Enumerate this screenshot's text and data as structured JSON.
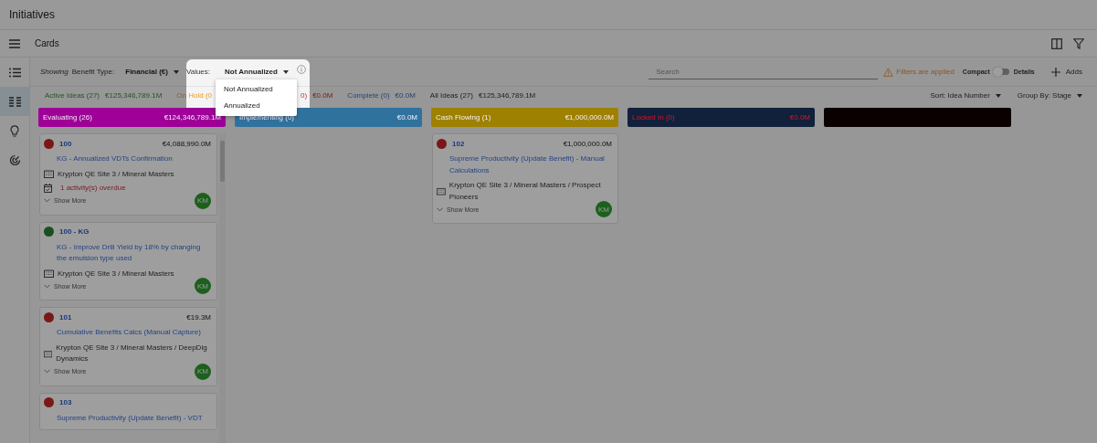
{
  "window": {
    "title": "Initiatives"
  },
  "header": {
    "title": "Cards"
  },
  "sidebar": {
    "items": [
      {
        "kind": "list",
        "selected": false
      },
      {
        "kind": "cards",
        "selected": true
      },
      {
        "kind": "idea",
        "selected": false
      },
      {
        "kind": "radar",
        "selected": false
      }
    ]
  },
  "toolbar": {
    "showing": "Showing",
    "benefit_type_label": "Benefit Type:",
    "benefit_type": "Financial (€)",
    "values_label": "Values:",
    "values": "Not Annualized",
    "values_options": [
      "Not Annualized",
      "Annualized"
    ],
    "search": {
      "placeholder": "Search"
    },
    "filters_notice": "Filters are applied",
    "toggle": {
      "off_label": "Compact",
      "on_label": "Details",
      "on": false
    },
    "add_button": "Adds"
  },
  "summary": [
    {
      "label": "Active Ideas (27)",
      "value": "€125,346,789.1M",
      "kind": "active"
    },
    {
      "label": "On Hold (0",
      "kind": "on_hold"
    },
    {
      "label": "0)",
      "value": "€0.0M",
      "kind": "alert"
    },
    {
      "label": "Complete (0)",
      "value": "€0.0M",
      "kind": "complete"
    },
    {
      "label": "All Ideas (27)",
      "value": "€125,346,789.1M",
      "kind": "all"
    }
  ],
  "sort": "Sort: Idea Number",
  "group_by": "Group By: Stage",
  "stages": [
    {
      "name": "Evaluating (26)",
      "kind": "normal",
      "amount": "€124,346,789.1M",
      "color": "#9e0098",
      "cards": [
        {
          "number": "100",
          "amount": "€4,088,990.0M",
          "color": "#7a1818",
          "title": "KG - Annualized VDTs Confirmation",
          "location": "Krypton QE Site 3 / Mineral Masters",
          "overdue": "1 activity(s) overdue",
          "show_more": "Show More",
          "owner": "KM"
        },
        {
          "number": "100 - KG",
          "color": "#1c4e1f",
          "title": "KG - Improve Drill Yield by 18% by changing the emulsion type used",
          "location": "Krypton QE Site 3 / Mineral Masters",
          "show_more": "Show More",
          "owner": "KM"
        },
        {
          "number": "101",
          "amount": "€19.3M",
          "color": "#7a1818",
          "title": "Cumulative Benefits Calcs (Manual Capture)",
          "location": "Krypton QE Site 3 / Mineral Masters / DeepDig Dynamics",
          "show_more": "Show More",
          "owner": "KM"
        },
        {
          "number": "103",
          "color": "#7a1818",
          "title": "Supreme Productivity (Update Benefit) - VDT"
        }
      ]
    },
    {
      "name": "Implementing (0)",
      "kind": "normal",
      "amount": "€0.0M",
      "color": "#30729e"
    },
    {
      "name": "Cash Flowing (1)",
      "kind": "normal",
      "amount": "€1,000,000.0M",
      "color": "#9e8100",
      "cards": [
        {
          "number": "102",
          "amount": "€1,000,000.0M",
          "color": "#7a1818",
          "title": "Supreme Productivity (Update Benefit) - Manual Calculations",
          "location": "Krypton QE Site 3 / Mineral Masters / Prospect Pioneers",
          "show_more": "Show More",
          "owner": "KM"
        }
      ]
    },
    {
      "name": "Locked In (0)",
      "kind": "alert",
      "amount": "€0.0M",
      "color": "#11203b"
    },
    {
      "color": "#0b0000"
    }
  ]
}
